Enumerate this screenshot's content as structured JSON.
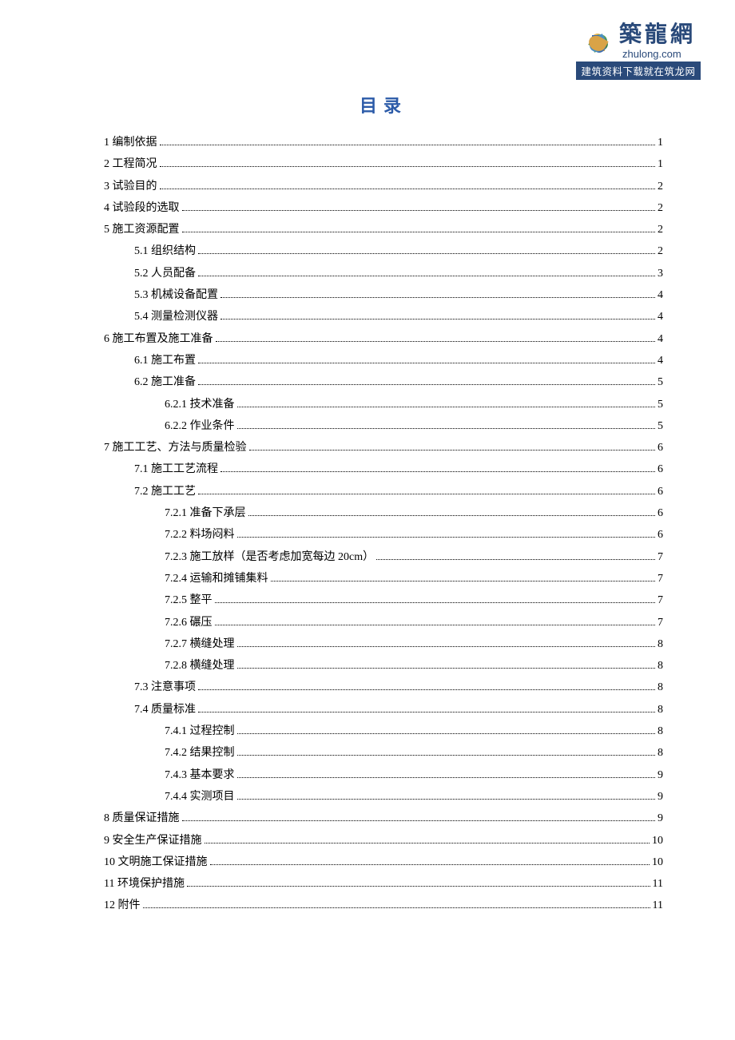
{
  "logo": {
    "cn": "築龍網",
    "en": "zhulong.com",
    "slogan": "建筑资料下载就在筑龙网"
  },
  "title": "目录",
  "toc": [
    {
      "level": 1,
      "label": "1  编制依据",
      "page": "1"
    },
    {
      "level": 1,
      "label": "2  工程简况",
      "page": "1"
    },
    {
      "level": 1,
      "label": "3  试验目的",
      "page": "2"
    },
    {
      "level": 1,
      "label": "4  试验段的选取",
      "page": "2"
    },
    {
      "level": 1,
      "label": "5  施工资源配置",
      "page": "2"
    },
    {
      "level": 2,
      "label": "5.1  组织结构",
      "page": "2"
    },
    {
      "level": 2,
      "label": "5.2 人员配备",
      "page": "3"
    },
    {
      "level": 2,
      "label": "5.3  机械设备配置",
      "page": "4"
    },
    {
      "level": 2,
      "label": "5.4  测量检测仪器",
      "page": "4"
    },
    {
      "level": 1,
      "label": "6  施工布置及施工准备",
      "page": "4"
    },
    {
      "level": 2,
      "label": "6.1  施工布置",
      "page": "4"
    },
    {
      "level": 2,
      "label": "6.2  施工准备",
      "page": "5"
    },
    {
      "level": 3,
      "label": "6.2.1  技术准备",
      "page": "5"
    },
    {
      "level": 3,
      "label": "6.2.2  作业条件",
      "page": "5"
    },
    {
      "level": 1,
      "label": "7  施工工艺、方法与质量检验",
      "page": "6"
    },
    {
      "level": 2,
      "label": "7.1  施工工艺流程",
      "page": "6"
    },
    {
      "level": 2,
      "label": "7.2  施工工艺",
      "page": "6"
    },
    {
      "level": 3,
      "label": "7.2.1  准备下承层",
      "page": "6"
    },
    {
      "level": 3,
      "label": "7.2.2  料场闷料",
      "page": "6"
    },
    {
      "level": 3,
      "label": "7.2.3  施工放样（是否考虑加宽每边 20cm）",
      "page": "7"
    },
    {
      "level": 3,
      "label": "7.2.4  运输和摊铺集料",
      "page": "7"
    },
    {
      "level": 3,
      "label": "7.2.5  整平",
      "page": "7"
    },
    {
      "level": 3,
      "label": "7.2.6  碾压",
      "page": "7"
    },
    {
      "level": 3,
      "label": "7.2.7  横缝处理",
      "page": "8"
    },
    {
      "level": 3,
      "label": "7.2.8  横缝处理",
      "page": "8"
    },
    {
      "level": 2,
      "label": "7.3  注意事项",
      "page": "8"
    },
    {
      "level": 2,
      "label": "7.4  质量标准",
      "page": "8"
    },
    {
      "level": 3,
      "label": "7.4.1  过程控制",
      "page": "8"
    },
    {
      "level": 3,
      "label": "7.4.2  结果控制",
      "page": "8"
    },
    {
      "level": 3,
      "label": "7.4.3   基本要求",
      "page": "9"
    },
    {
      "level": 3,
      "label": "7.4.4   实测项目",
      "page": "9"
    },
    {
      "level": 1,
      "label": "8  质量保证措施",
      "page": "9"
    },
    {
      "level": 1,
      "label": "9  安全生产保证措施",
      "page": "10"
    },
    {
      "level": 1,
      "label": "10  文明施工保证措施",
      "page": "10"
    },
    {
      "level": 1,
      "label": "11  环境保护措施",
      "page": "11"
    },
    {
      "level": 1,
      "label": "12  附件",
      "page": "11"
    }
  ]
}
